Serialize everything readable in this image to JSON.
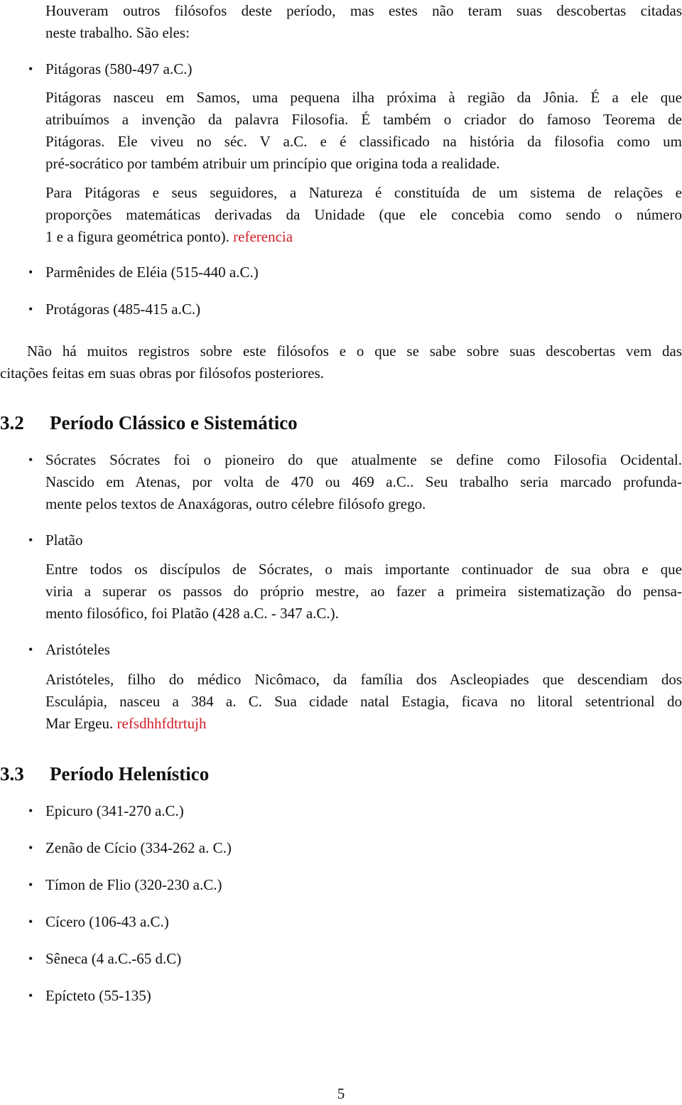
{
  "intro": {
    "lines": [
      "Houveram outros filósofos deste período, mas estes não teram suas descobertas citadas",
      "neste trabalho. São eles:"
    ]
  },
  "section_31_items": [
    {
      "title": "Pitágoras (580-497 a.C.)",
      "paragraphs": [
        {
          "lines": [
            "Pitágoras nasceu em Samos, uma pequena ilha próxima à região da Jônia.  É a ele que",
            "atribuímos a invenção da palavra Filosofia. É também o criador do famoso Teorema de",
            "Pitágoras.  Ele viveu no séc.  V a.C. e é classificado na história da filosofia como um",
            "pré-socrático por também atribuir um princípio que origina toda a realidade."
          ]
        },
        {
          "lines": [
            "Para Pitágoras e seus seguidores, a Natureza é constituída de um sistema de relações e",
            "proporções matemáticas derivadas da Unidade (que ele concebia como sendo o número",
            "1 e a figura geométrica ponto)."
          ],
          "link": "referencia"
        }
      ]
    },
    {
      "title": "Parmênides de Eléia (515-440 a.C.)"
    },
    {
      "title": "Protágoras (485-415 a.C.)"
    }
  ],
  "closing_paragraph": {
    "lines": [
      "Não há muitos registros sobre este filósofos e o que se sabe sobre suas descobertas vem das",
      "citações feitas em suas obras por filósofos posteriores."
    ]
  },
  "section_32": {
    "number": "3.2",
    "title": "Período Clássico e Sistemático",
    "items": [
      {
        "lines": [
          "Sócrates Sócrates foi o pioneiro do que atualmente se define como Filosofia Ocidental.",
          "Nascido em Atenas, por volta de 470 ou 469 a.C..  Seu trabalho seria marcado profunda-",
          "mente pelos textos de Anaxágoras, outro célebre filósofo grego."
        ]
      },
      {
        "title": "Platão",
        "lines": [
          "Entre todos os discípulos de Sócrates, o mais importante continuador de sua obra e que",
          "viria a superar os passos do próprio mestre, ao fazer a primeira sistematização do pensa-",
          "mento filosófico, foi Platão (428 a.C. - 347 a.C.)."
        ]
      },
      {
        "title": "Aristóteles",
        "lines": [
          "Aristóteles, filho do médico Nicômaco, da família dos Ascleopiades que descendiam dos",
          "Esculápia, nasceu a 384 a.  C. Sua cidade natal Estagia, ficava no litoral setentrional do",
          "Mar Ergeu."
        ],
        "link": "refsdhhfdtrtujh"
      }
    ]
  },
  "section_33": {
    "number": "3.3",
    "title": "Período Helenístico",
    "items": [
      "Epicuro (341-270 a.C.)",
      "Zenão de Cício (334-262 a.  C.)",
      "Tímon de Flio (320-230 a.C.)",
      "Cícero (106-43 a.C.)",
      "Sêneca (4 a.C.-65 d.C)",
      "Epícteto (55-135)"
    ]
  },
  "page_number": "5",
  "colors": {
    "link_red": "#d0202a",
    "text": "#111111"
  }
}
